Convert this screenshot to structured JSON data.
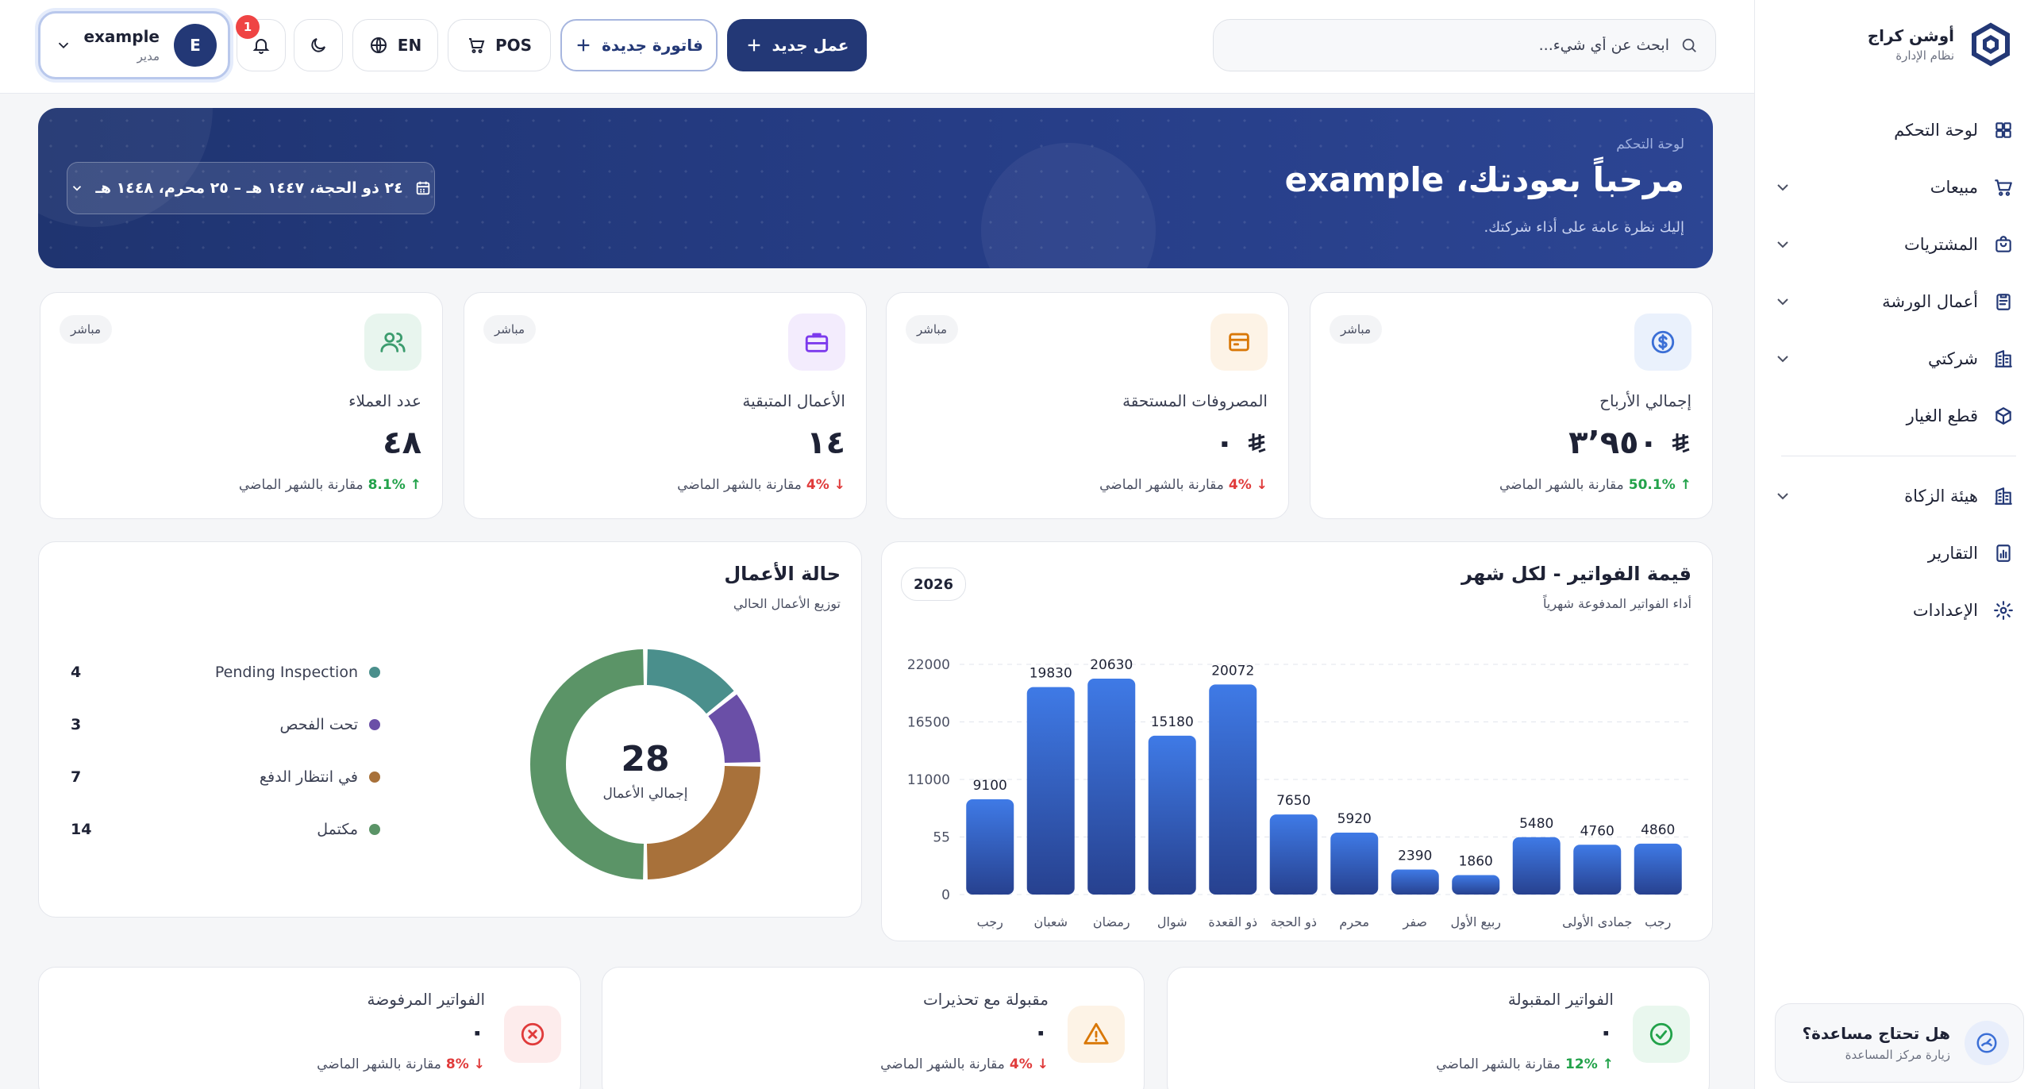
{
  "brand": {
    "name": "أوشن كراج",
    "subtitle": "نظام الإدارة"
  },
  "sidebar": {
    "items": [
      {
        "label": "لوحة التحكم",
        "icon": "dashboard-icon",
        "expandable": false
      },
      {
        "label": "مبيعات",
        "icon": "cart-icon",
        "expandable": true
      },
      {
        "label": "المشتريات",
        "icon": "bag-icon",
        "expandable": true
      },
      {
        "label": "أعمال الورشة",
        "icon": "clipboard-icon",
        "expandable": true
      },
      {
        "label": "شركتي",
        "icon": "building-icon",
        "expandable": true
      },
      {
        "label": "قطع الغيار",
        "icon": "box-icon",
        "expandable": false
      },
      {
        "label": "هيئة الزكاة",
        "icon": "building-icon",
        "expandable": true
      },
      {
        "label": "التقارير",
        "icon": "report-icon",
        "expandable": false
      },
      {
        "label": "الإعدادات",
        "icon": "gear-icon",
        "expandable": false
      }
    ],
    "help": {
      "title": "هل تحتاج مساعدة؟",
      "subtitle": "زيارة مركز المساعدة"
    }
  },
  "topbar": {
    "search_placeholder": "ابحث عن أي شيء...",
    "new_job": "عمل جديد",
    "new_invoice": "فاتورة جديدة",
    "pos": "POS",
    "lang": "EN",
    "notifications_count": "1",
    "user": {
      "initial": "E",
      "name": "example",
      "role": "مدير"
    }
  },
  "hero": {
    "kicker": "لوحة التحكم",
    "title": "مرحباً بعودتك، example",
    "subtitle": "إليك نظرة عامة على أداء شركتك.",
    "date_range": "٢٤ ذو الحجة، ١٤٤٧ هـ – ٢٥ محرم، ١٤٤٨ هـ"
  },
  "stats": [
    {
      "title": "إجمالي الأرباح",
      "value": "٣٬٩٥٠",
      "currency": true,
      "badge": "مباشر",
      "trend_dir": "up",
      "trend_value": "50.1%",
      "trend_text": "مقارنة بالشهر الماضي",
      "icon": "dollar-icon",
      "color": "#3b6fd6",
      "bg": "#eaf1fc"
    },
    {
      "title": "المصروفات المستحقة",
      "value": "٠",
      "currency": true,
      "badge": "مباشر",
      "trend_dir": "down",
      "trend_value": "4%",
      "trend_text": "مقارنة بالشهر الماضي",
      "icon": "wallet-icon",
      "color": "#d97706",
      "bg": "#fdf3e6"
    },
    {
      "title": "الأعمال المتبقية",
      "value": "١٤",
      "currency": false,
      "badge": "مباشر",
      "trend_dir": "down",
      "trend_value": "4%",
      "trend_text": "مقارنة بالشهر الماضي",
      "icon": "briefcase-icon",
      "color": "#7c3aed",
      "bg": "#f3ecfd"
    },
    {
      "title": "عدد العملاء",
      "value": "٤٨",
      "currency": false,
      "badge": "مباشر",
      "trend_dir": "up",
      "trend_value": "8.1%",
      "trend_text": "مقارنة بالشهر الماضي",
      "icon": "users-icon",
      "color": "#3c9c6e",
      "bg": "#e8f5ee"
    }
  ],
  "invoices_chart": {
    "title": "قيمة الفواتير - لكل شهر",
    "subtitle": "أداء الفواتير المدفوعة شهرياً",
    "year": "2026"
  },
  "status_chart": {
    "title": "حالة الأعمال",
    "subtitle": "توزيع الأعمال الحالي",
    "total": "28",
    "total_label": "إجمالي الأعمال",
    "legend": [
      {
        "name": "Pending Inspection",
        "count": "4",
        "color": "#4a8f8c"
      },
      {
        "name": "تحت الفحص",
        "count": "3",
        "color": "#6a4fa7"
      },
      {
        "name": "في انتظار الدفع",
        "count": "7",
        "color": "#a8713a"
      },
      {
        "name": "مكتمل",
        "count": "14",
        "color": "#5b9467"
      }
    ]
  },
  "mini_cards": [
    {
      "title": "الفواتير المقبولة",
      "value": "٠",
      "trend_dir": "up",
      "trend_value": "12%",
      "trend_text": "مقارنة بالشهر الماضي",
      "icon": "check-circle-icon",
      "color": "#22a24a",
      "bg": "#e9f7ee"
    },
    {
      "title": "مقبولة مع تحذيرات",
      "value": "٠",
      "trend_dir": "down",
      "trend_value": "4%",
      "trend_text": "مقارنة بالشهر الماضي",
      "icon": "warning-icon",
      "color": "#d97706",
      "bg": "#fdf3e6"
    },
    {
      "title": "الفواتير المرفوضة",
      "value": "٠",
      "trend_dir": "down",
      "trend_value": "8%",
      "trend_text": "مقارنة بالشهر الماضي",
      "icon": "x-circle-icon",
      "color": "#e03b3b",
      "bg": "#fdecec"
    }
  ],
  "chart_data": [
    {
      "type": "bar",
      "title": "قيمة الفواتير - لكل شهر",
      "subtitle": "أداء الفواتير المدفوعة شهرياً",
      "categories": [
        "رجب",
        "شعبان",
        "رمضان",
        "شوال",
        "ذو القعدة",
        "ذو الحجة",
        "محرم",
        "صفر",
        "ربيع الأول",
        "",
        "جمادى الأولى",
        "رجب"
      ],
      "values": [
        9100,
        19830,
        20630,
        15180,
        20072,
        7650,
        5920,
        2390,
        1860,
        5480,
        4760,
        4860
      ],
      "y_ticks": [
        "0",
        "55",
        "11000",
        "16500",
        "22000"
      ],
      "ylim": [
        0,
        22000
      ],
      "grid": true,
      "color": "#3a6fd8"
    },
    {
      "type": "pie",
      "title": "حالة الأعمال",
      "subtitle": "توزيع الأعمال الحالي",
      "labels": [
        "Pending Inspection",
        "تحت الفحص",
        "في انتظار الدفع",
        "مكتمل"
      ],
      "values": [
        4,
        3,
        7,
        14
      ],
      "colors": [
        "#4a8f8c",
        "#6a4fa7",
        "#a8713a",
        "#5b9467"
      ],
      "center_value": "28",
      "center_label": "إجمالي الأعمال"
    }
  ]
}
